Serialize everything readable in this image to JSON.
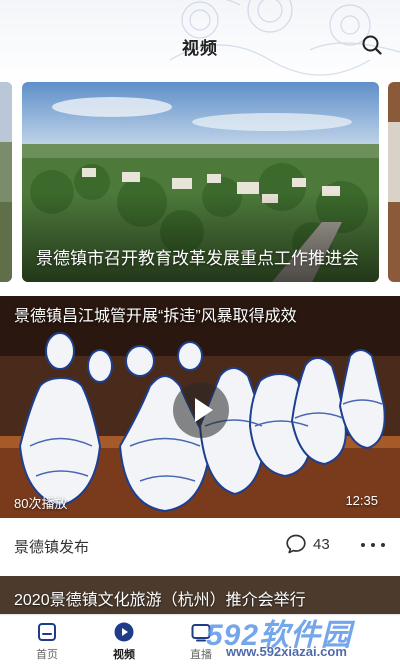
{
  "header": {
    "title": "视频",
    "search_icon": "search-icon"
  },
  "banner": {
    "title": "景德镇市召开教育改革发展重点工作推进会"
  },
  "video": {
    "title": "景德镇昌江城管开展“拆违”风暴取得成效",
    "plays": "80次播放",
    "duration": "12:35",
    "source": "景德镇发布",
    "comments": "43"
  },
  "next_card": {
    "title": "2020景德镇文化旅游（杭州）推介会举行"
  },
  "tabbar": {
    "items": [
      {
        "label": "首页",
        "icon": "home-icon"
      },
      {
        "label": "视频",
        "icon": "video-play-icon",
        "active": true
      },
      {
        "label": "直播",
        "icon": "tv-icon"
      }
    ]
  },
  "watermark": {
    "brand": "592软件园",
    "url": "www.592xiazai.com"
  },
  "colors": {
    "accent": "#1f3c88",
    "text": "#222222",
    "muted": "#666666"
  }
}
